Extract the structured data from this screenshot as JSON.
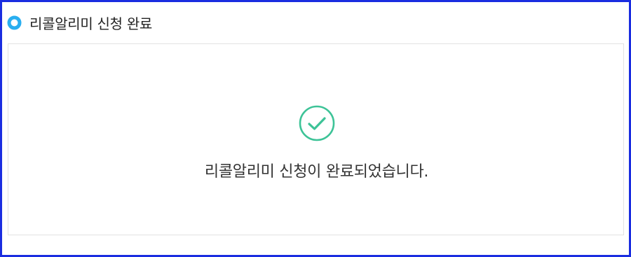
{
  "header": {
    "bullet_icon": "circle-bullet-icon",
    "bullet_color": "#29aef0",
    "title": "리콜알리미 신청 완료"
  },
  "result": {
    "status_icon": "check-circle-icon",
    "status_color": "#3dc397",
    "message": "리콜알리미 신청이 완료되었습니다."
  },
  "frame": {
    "border_color": "#1a2de0"
  }
}
